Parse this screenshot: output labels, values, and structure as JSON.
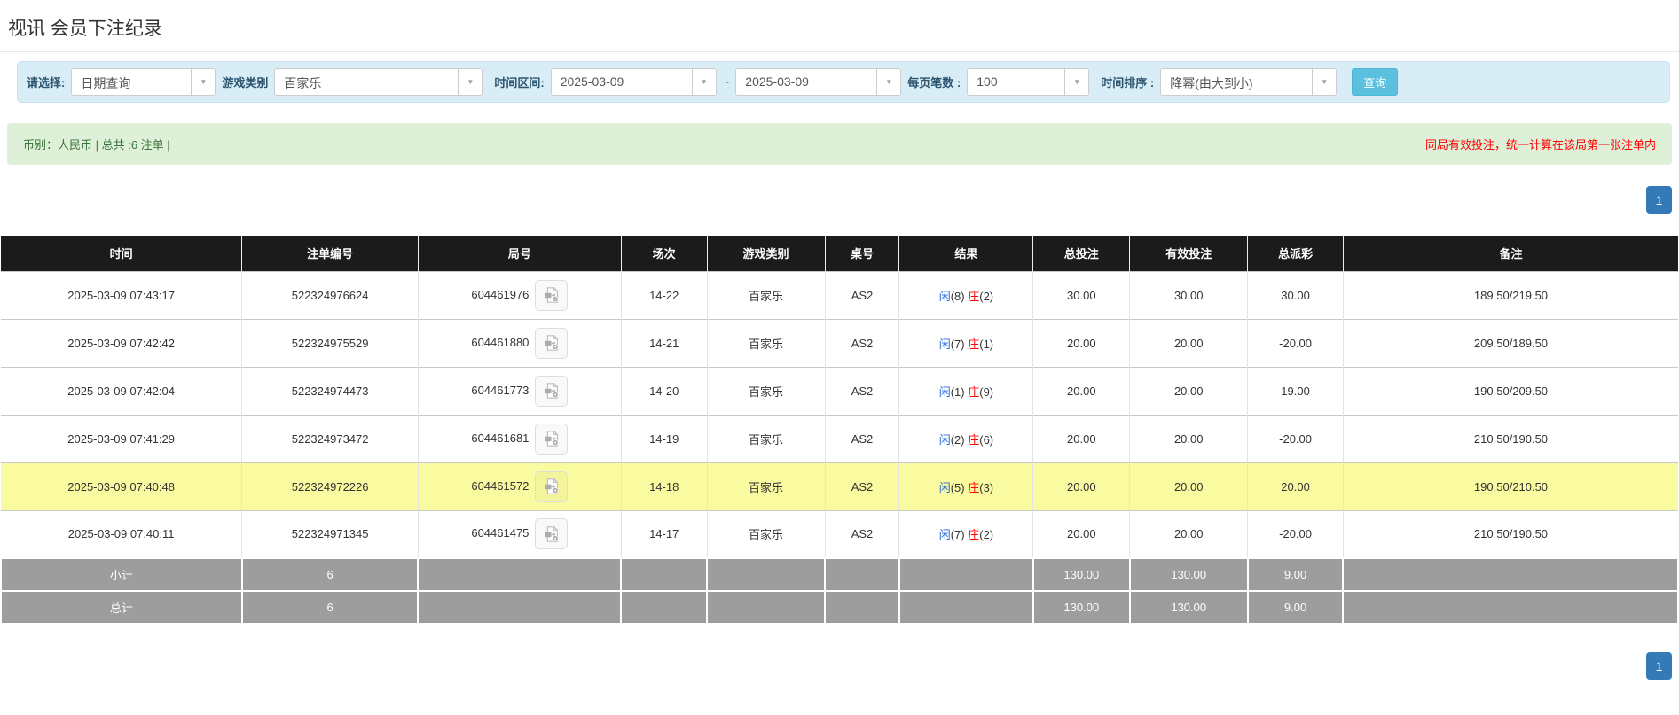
{
  "page": {
    "title": "视讯 会员下注纪录"
  },
  "filters": {
    "query_type_label": "请选择:",
    "query_type_value": "日期查询",
    "game_type_label": "游戏类别",
    "game_type_value": "百家乐",
    "date_range_label": "时间区间:",
    "date_from": "2025-03-09",
    "date_separator": "~",
    "date_to": "2025-03-09",
    "page_size_label": "每页笔数 :",
    "page_size_value": "100",
    "sort_label": "时间排序 :",
    "sort_value": "降幂(由大到小)",
    "search_button": "查询"
  },
  "summary_bar": {
    "left_text": "币别：人民币 | 总共 :6 注单 |",
    "right_text": "同局有效投注，统一计算在该局第一张注单内"
  },
  "pagination": {
    "page": "1"
  },
  "table": {
    "headers": [
      "时间",
      "注单编号",
      "局号",
      "场次",
      "游戏类别",
      "桌号",
      "结果",
      "总投注",
      "有效投注",
      "总派彩",
      "备注"
    ],
    "rows": [
      {
        "time": "2025-03-09 07:43:17",
        "bet_no": "522324976624",
        "round_no": "604461976",
        "session": "14-22",
        "game": "百家乐",
        "table_no": "AS2",
        "player_label": "闲",
        "player_count": "(8)",
        "banker_label": "庄",
        "banker_count": "(2)",
        "total_bet": "30.00",
        "valid_bet": "30.00",
        "payout": "30.00",
        "payout_negative": false,
        "remark": "189.50/219.50",
        "highlight": false
      },
      {
        "time": "2025-03-09 07:42:42",
        "bet_no": "522324975529",
        "round_no": "604461880",
        "session": "14-21",
        "game": "百家乐",
        "table_no": "AS2",
        "player_label": "闲",
        "player_count": "(7)",
        "banker_label": "庄",
        "banker_count": "(1)",
        "total_bet": "20.00",
        "valid_bet": "20.00",
        "payout": "-20.00",
        "payout_negative": true,
        "remark": "209.50/189.50",
        "highlight": false
      },
      {
        "time": "2025-03-09 07:42:04",
        "bet_no": "522324974473",
        "round_no": "604461773",
        "session": "14-20",
        "game": "百家乐",
        "table_no": "AS2",
        "player_label": "闲",
        "player_count": "(1)",
        "banker_label": "庄",
        "banker_count": "(9)",
        "total_bet": "20.00",
        "valid_bet": "20.00",
        "payout": "19.00",
        "payout_negative": false,
        "remark": "190.50/209.50",
        "highlight": false
      },
      {
        "time": "2025-03-09 07:41:29",
        "bet_no": "522324973472",
        "round_no": "604461681",
        "session": "14-19",
        "game": "百家乐",
        "table_no": "AS2",
        "player_label": "闲",
        "player_count": "(2)",
        "banker_label": "庄",
        "banker_count": "(6)",
        "total_bet": "20.00",
        "valid_bet": "20.00",
        "payout": "-20.00",
        "payout_negative": true,
        "remark": "210.50/190.50",
        "highlight": false
      },
      {
        "time": "2025-03-09 07:40:48",
        "bet_no": "522324972226",
        "round_no": "604461572",
        "session": "14-18",
        "game": "百家乐",
        "table_no": "AS2",
        "player_label": "闲",
        "player_count": "(5)",
        "banker_label": "庄",
        "banker_count": "(3)",
        "total_bet": "20.00",
        "valid_bet": "20.00",
        "payout": "20.00",
        "payout_negative": false,
        "remark": "190.50/210.50",
        "highlight": true
      },
      {
        "time": "2025-03-09 07:40:11",
        "bet_no": "522324971345",
        "round_no": "604461475",
        "session": "14-17",
        "game": "百家乐",
        "table_no": "AS2",
        "player_label": "闲",
        "player_count": "(7)",
        "banker_label": "庄",
        "banker_count": "(2)",
        "total_bet": "20.00",
        "valid_bet": "20.00",
        "payout": "-20.00",
        "payout_negative": true,
        "remark": "210.50/190.50",
        "highlight": false
      }
    ],
    "subtotal": {
      "label": "小计",
      "count": "6",
      "total_bet": "130.00",
      "valid_bet": "130.00",
      "payout": "9.00"
    },
    "total": {
      "label": "总计",
      "count": "6",
      "total_bet": "130.00",
      "valid_bet": "130.00",
      "payout": "9.00"
    }
  },
  "colors": {
    "header_bg": "#1b1b1b",
    "highlight_row": "#fafaa0",
    "link_blue": "#2468d9",
    "negative_red": "#ff0000",
    "summary_green_bg": "#dff0d8",
    "summary_green_text": "#3c763d",
    "filter_panel_bg": "#d9edf7",
    "search_button_bg": "#5bc0de",
    "pager_blue": "#337ab7",
    "totals_gray": "#9d9d9d"
  }
}
